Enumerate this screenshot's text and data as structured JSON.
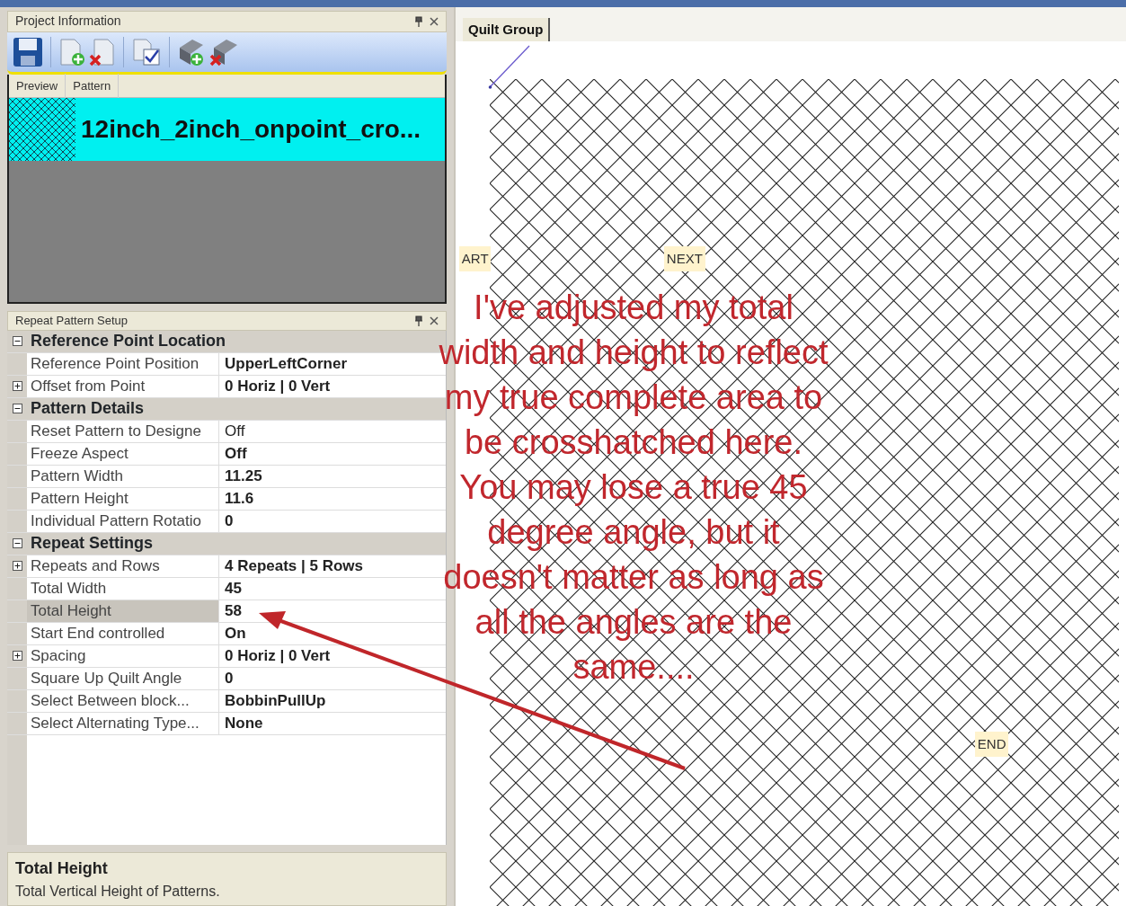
{
  "project_panel": {
    "title": "Project Information"
  },
  "pattern_list": {
    "columns": [
      "Preview",
      "Pattern"
    ],
    "rows": [
      {
        "name": "12inch_2inch_onpoint_cro...",
        "selected": true
      }
    ]
  },
  "properties": {
    "title": "Repeat Pattern Setup",
    "categories": [
      {
        "name": "Reference Point Location",
        "expanded": true,
        "items": [
          {
            "label": "Reference Point Position",
            "value": "UpperLeftCorner",
            "expandable": false,
            "modified": true,
            "selected": false
          },
          {
            "label": "Offset from Point",
            "value": "0 Horiz | 0 Vert",
            "expandable": true,
            "modified": true,
            "selected": false
          }
        ]
      },
      {
        "name": "Pattern Details",
        "expanded": true,
        "items": [
          {
            "label": "Reset Pattern to Designe",
            "value": "Off",
            "expandable": false,
            "modified": false,
            "selected": false
          },
          {
            "label": "Freeze Aspect",
            "value": "Off",
            "expandable": false,
            "modified": true,
            "selected": false
          },
          {
            "label": "Pattern Width",
            "value": "11.25",
            "expandable": false,
            "modified": true,
            "selected": false
          },
          {
            "label": "Pattern Height",
            "value": "11.6",
            "expandable": false,
            "modified": true,
            "selected": false
          },
          {
            "label": "Individual Pattern Rotatio",
            "value": "0",
            "expandable": false,
            "modified": true,
            "selected": false
          }
        ]
      },
      {
        "name": "Repeat Settings",
        "expanded": true,
        "items": [
          {
            "label": "Repeats and Rows",
            "value": "4 Repeats | 5 Rows",
            "expandable": true,
            "modified": true,
            "selected": false
          },
          {
            "label": "Total Width",
            "value": "45",
            "expandable": false,
            "modified": true,
            "selected": false
          },
          {
            "label": "Total Height",
            "value": "58",
            "expandable": false,
            "modified": true,
            "selected": true
          },
          {
            "label": "Start End controlled",
            "value": "On",
            "expandable": false,
            "modified": true,
            "selected": false
          },
          {
            "label": "Spacing",
            "value": "0 Horiz | 0 Vert",
            "expandable": true,
            "modified": true,
            "selected": false
          },
          {
            "label": "Square Up Quilt Angle",
            "value": "0",
            "expandable": false,
            "modified": true,
            "selected": false
          },
          {
            "label": "Select Between block...",
            "value": "BobbinPullUp",
            "expandable": false,
            "modified": true,
            "selected": false
          },
          {
            "label": "Select Alternating Type...",
            "value": "None",
            "expandable": false,
            "modified": true,
            "selected": false
          }
        ]
      }
    ]
  },
  "description": {
    "title": "Total Height",
    "text": "Total Vertical Height of Patterns."
  },
  "canvas": {
    "tab": "Quilt Group",
    "markers": [
      {
        "text": "ART"
      },
      {
        "text": "NEXT"
      },
      {
        "text": "END"
      }
    ]
  },
  "annotation": {
    "lines": [
      "I've adjusted my total",
      "width and height to reflect",
      "my true complete area to",
      "be crosshatched here.",
      "You may lose a true 45",
      "degree angle, but it",
      "doesn't matter as long as",
      "all the angles are the",
      "same...."
    ]
  }
}
